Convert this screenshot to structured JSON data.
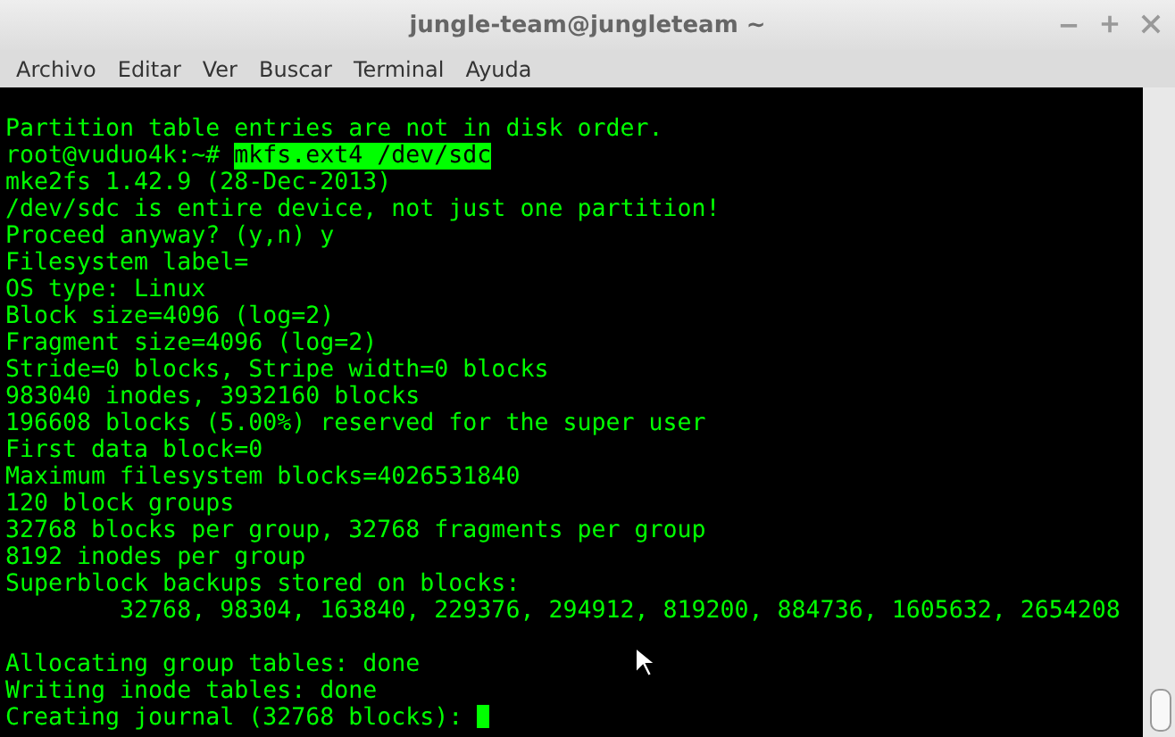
{
  "window": {
    "title": "jungle-team@jungleteam ~"
  },
  "menu": [
    {
      "label": "Archivo"
    },
    {
      "label": "Editar"
    },
    {
      "label": "Ver"
    },
    {
      "label": "Buscar"
    },
    {
      "label": "Terminal"
    },
    {
      "label": "Ayuda"
    }
  ],
  "terminal": {
    "lines": [
      {
        "kind": "blank"
      },
      {
        "kind": "output",
        "text": "Partition table entries are not in disk order."
      },
      {
        "kind": "prompt",
        "prompt": "root@vuduo4k:~# ",
        "command": "mkfs.ext4 /dev/sdc"
      },
      {
        "kind": "output",
        "text": "mke2fs 1.42.9 (28-Dec-2013)"
      },
      {
        "kind": "output",
        "text": "/dev/sdc is entire device, not just one partition!"
      },
      {
        "kind": "output",
        "text": "Proceed anyway? (y,n) y"
      },
      {
        "kind": "output",
        "text": "Filesystem label="
      },
      {
        "kind": "output",
        "text": "OS type: Linux"
      },
      {
        "kind": "output",
        "text": "Block size=4096 (log=2)"
      },
      {
        "kind": "output",
        "text": "Fragment size=4096 (log=2)"
      },
      {
        "kind": "output",
        "text": "Stride=0 blocks, Stripe width=0 blocks"
      },
      {
        "kind": "output",
        "text": "983040 inodes, 3932160 blocks"
      },
      {
        "kind": "output",
        "text": "196608 blocks (5.00%) reserved for the super user"
      },
      {
        "kind": "output",
        "text": "First data block=0"
      },
      {
        "kind": "output",
        "text": "Maximum filesystem blocks=4026531840"
      },
      {
        "kind": "output",
        "text": "120 block groups"
      },
      {
        "kind": "output",
        "text": "32768 blocks per group, 32768 fragments per group"
      },
      {
        "kind": "output",
        "text": "8192 inodes per group"
      },
      {
        "kind": "output",
        "text": "Superblock backups stored on blocks:"
      },
      {
        "kind": "output",
        "text": "        32768, 98304, 163840, 229376, 294912, 819200, 884736, 1605632, 2654208"
      },
      {
        "kind": "blank"
      },
      {
        "kind": "output",
        "text": "Allocating group tables: done"
      },
      {
        "kind": "output",
        "text": "Writing inode tables: done"
      },
      {
        "kind": "cursor",
        "text": "Creating journal (32768 blocks): "
      }
    ]
  }
}
